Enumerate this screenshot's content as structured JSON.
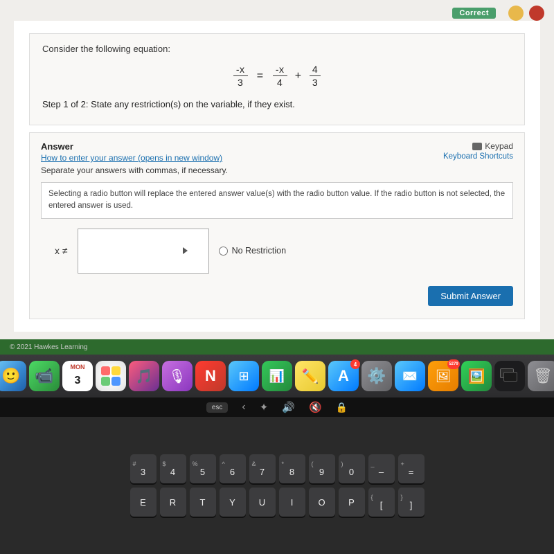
{
  "browser": {
    "correct_badge": "Correct",
    "consider_text": "Consider the following equation:",
    "equation": {
      "left_num": "-x",
      "left_den": "3",
      "eq": "=",
      "right1_num": "-x",
      "right1_den": "4",
      "plus": "+",
      "right2_num": "4",
      "right2_den": "3"
    },
    "step_text": "Step 1 of 2:",
    "step_detail": "  State any restriction(s) on the variable, if they exist.",
    "answer_label": "Answer",
    "answer_link": "How to enter your answer (opens in new window)",
    "keypad_label": "Keypad",
    "keyboard_shortcuts_label": "Keyboard Shortcuts",
    "separate_text": "Separate your answers with commas, if necessary.",
    "radio_info": "Selecting a radio button will replace the entered answer value(s) with the radio button value. If the radio button is not selected, the entered answer is used.",
    "x_neq": "x ≠",
    "no_restriction_label": "No Restriction",
    "submit_label": "Submit Answer",
    "footer_text": "© 2021 Hawkes Learning"
  },
  "dock": {
    "icons": [
      {
        "name": "Finder",
        "type": "finder"
      },
      {
        "name": "FaceTime",
        "type": "facetime"
      },
      {
        "name": "Calendar",
        "type": "three-badge",
        "label": "3"
      },
      {
        "name": "Photos",
        "type": "photos"
      },
      {
        "name": "Music",
        "type": "music"
      },
      {
        "name": "Podcasts",
        "type": "podcasts"
      },
      {
        "name": "News",
        "type": "news"
      },
      {
        "name": "Finder2",
        "type": "finder2"
      },
      {
        "name": "Numbers",
        "type": "numbers"
      },
      {
        "name": "Notes",
        "type": "notes"
      },
      {
        "name": "AppStore",
        "type": "appstore",
        "badge": "4"
      },
      {
        "name": "Settings",
        "type": "settings"
      },
      {
        "name": "Mail",
        "type": "mail"
      },
      {
        "name": "Mail2",
        "type": "mail2",
        "badge": "5279"
      },
      {
        "name": "Photos2",
        "type": "photos2"
      },
      {
        "name": "Multi",
        "type": "multi"
      },
      {
        "name": "Trash",
        "type": "trash"
      }
    ]
  },
  "touchbar": {
    "items": [
      "esc",
      "⟨",
      "✦",
      "🔊",
      "🔇",
      "🔒"
    ]
  },
  "keyboard": {
    "row1": [
      {
        "top": "#",
        "main": "3"
      },
      {
        "top": "$",
        "main": "4"
      },
      {
        "top": "%",
        "main": "5"
      },
      {
        "top": "^",
        "main": "6"
      },
      {
        "top": "&",
        "main": "7"
      },
      {
        "top": "*",
        "main": "8"
      },
      {
        "top": "(",
        "main": "9"
      },
      {
        "top": ")",
        "main": "0"
      },
      {
        "top": "_",
        "main": "-"
      },
      {
        "top": "+",
        "main": "="
      }
    ],
    "row2": [
      {
        "main": "E"
      },
      {
        "main": "R"
      },
      {
        "main": "T"
      },
      {
        "main": "Y"
      },
      {
        "main": "U"
      },
      {
        "main": "I"
      },
      {
        "main": "O"
      },
      {
        "main": "P"
      },
      {
        "top": "{",
        "main": "["
      },
      {
        "top": "}",
        "main": "]"
      }
    ]
  }
}
